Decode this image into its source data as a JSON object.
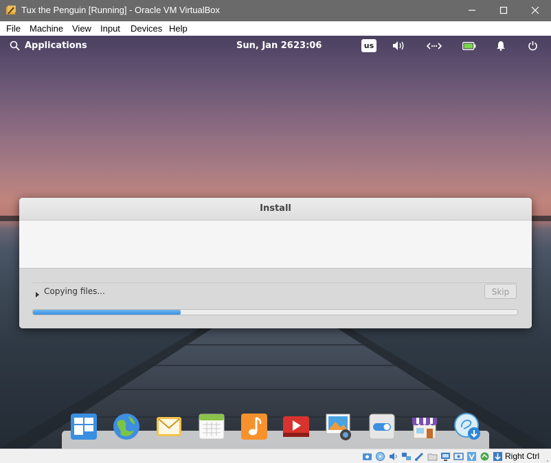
{
  "window": {
    "title": "Tux the Penguin [Running] - Oracle VM VirtualBox",
    "controls": [
      "minimize-icon",
      "maximize-icon",
      "close-icon"
    ]
  },
  "menubar": {
    "items": [
      "File",
      "Machine",
      "View",
      "Input",
      "Devices",
      "Help"
    ]
  },
  "panel": {
    "applications_label": "Applications",
    "date": "Sun, Jan 26",
    "time": "23:06",
    "keyboard_layout": "us",
    "indicators": [
      "volume-icon",
      "network-icon",
      "battery-icon",
      "notifications-icon",
      "power-icon"
    ]
  },
  "install_dialog": {
    "title": "Install",
    "status": "Copying files...",
    "skip_label": "Skip",
    "progress": 0.305
  },
  "dock": {
    "apps": [
      "multitasking-view-icon",
      "web-browser-icon",
      "mail-icon",
      "calendar-icon",
      "music-icon",
      "videos-icon",
      "photos-icon",
      "system-settings-icon",
      "appcenter-icon",
      "installer-icon"
    ]
  },
  "vbox_statusbar": {
    "indicators": [
      "hard-disk-icon",
      "optical-drive-icon",
      "audio-icon",
      "network-adapter-icon",
      "usb-icon",
      "shared-folders-icon",
      "display-icon",
      "video-capture-icon",
      "virtualization-icon",
      "mouse-integration-icon",
      "keyboard-capture-icon"
    ],
    "host_key": "Right Ctrl"
  },
  "colors": {
    "titlebar": "#6a6a6a",
    "progress_fill": "#3b8ee0",
    "dialog_bg": "#f5f5f5"
  }
}
